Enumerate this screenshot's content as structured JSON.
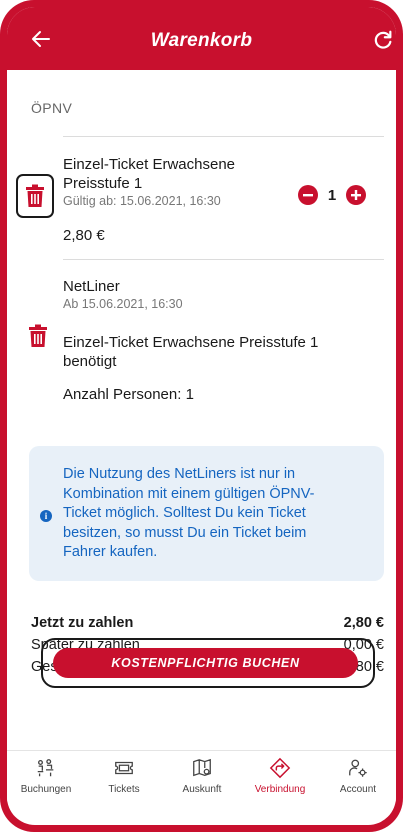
{
  "header": {
    "title": "Warenkorb"
  },
  "cart": {
    "section_label": "ÖPNV",
    "item1": {
      "title_line1": "Einzel-Ticket Erwachsene",
      "title_line2": "Preisstufe 1",
      "valid": "Gültig ab: 15.06.2021, 16:30",
      "quantity": "1",
      "price": "2,80 €"
    },
    "item2": {
      "title": "NetLiner",
      "date": "Ab 15.06.2021, 16:30",
      "requirement_line1": "Einzel-Ticket Erwachsene Preisstufe 1",
      "requirement_line2": "benötigt",
      "persons": "Anzahl Personen: 1"
    },
    "info": {
      "line1": "Die Nutzung des NetLiners ist nur in",
      "line2": "Kombination mit einem gültigen ÖPNV-",
      "line3": "Ticket möglich. Solltest Du kein Ticket",
      "line4": "besitzen, so musst Du ein Ticket beim",
      "line5": "Fahrer kaufen.",
      "color": "#1565c0"
    }
  },
  "totals": {
    "now_label": "Jetzt zu zahlen",
    "now_value": "2,80 €",
    "later_label": "Später zu zahlen",
    "later_value": "0,00 €",
    "total_label": "Gesamtkosten",
    "total_value": "2,80 €"
  },
  "book_button": "KOSTENPFLICHTIG BUCHEN",
  "tabs": [
    {
      "label": "Buchungen",
      "icon": "bookings-icon"
    },
    {
      "label": "Tickets",
      "icon": "ticket-icon"
    },
    {
      "label": "Auskunft",
      "icon": "map-icon"
    },
    {
      "label": "Verbindung",
      "icon": "route-icon",
      "active": true
    },
    {
      "label": "Account",
      "icon": "account-icon"
    }
  ],
  "colors": {
    "brand": "#c8102e",
    "info_background": "#e8f0f8"
  }
}
